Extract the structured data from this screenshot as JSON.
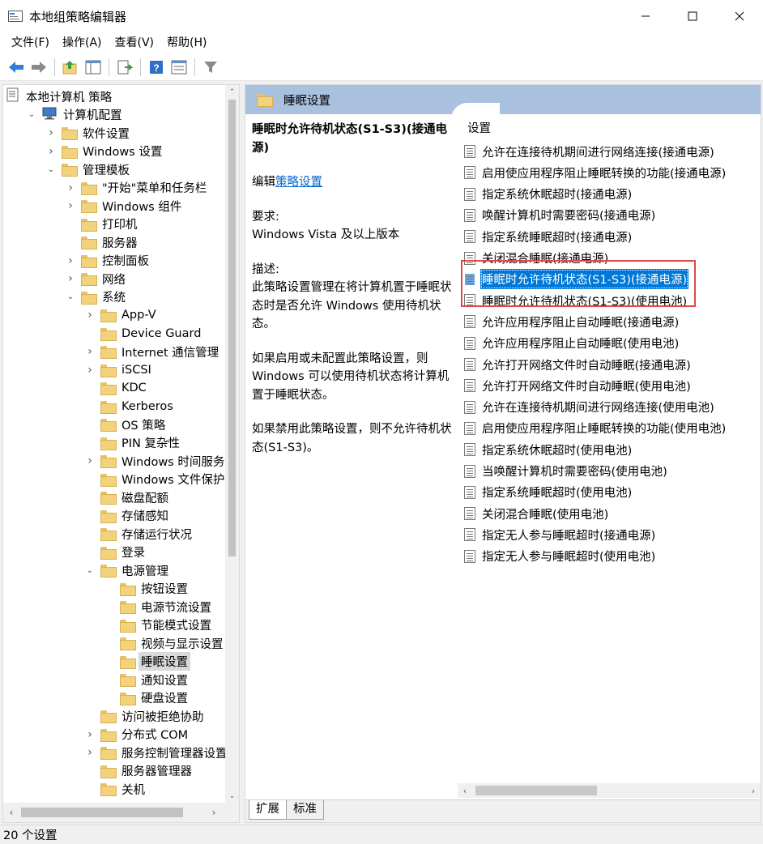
{
  "window": {
    "title": "本地组策略编辑器"
  },
  "menubar": [
    {
      "label": "文件(F)"
    },
    {
      "label": "操作(A)"
    },
    {
      "label": "查看(V)"
    },
    {
      "label": "帮助(H)"
    }
  ],
  "tree": [
    {
      "label": "本地计算机 策略",
      "level": 0,
      "expander": "",
      "icon": "policy-icon"
    },
    {
      "label": "计算机配置",
      "level": 1,
      "expander": "open",
      "icon": "computer-icon"
    },
    {
      "label": "软件设置",
      "level": 2,
      "expander": "closed",
      "icon": "folder-icon"
    },
    {
      "label": "Windows 设置",
      "level": 2,
      "expander": "closed",
      "icon": "folder-icon"
    },
    {
      "label": "管理模板",
      "level": 2,
      "expander": "open",
      "icon": "folder-icon"
    },
    {
      "label": "\"开始\"菜单和任务栏",
      "level": 3,
      "expander": "closed",
      "icon": "folder-icon"
    },
    {
      "label": "Windows 组件",
      "level": 3,
      "expander": "closed",
      "icon": "folder-icon"
    },
    {
      "label": "打印机",
      "level": 3,
      "expander": "",
      "icon": "folder-icon"
    },
    {
      "label": "服务器",
      "level": 3,
      "expander": "",
      "icon": "folder-icon"
    },
    {
      "label": "控制面板",
      "level": 3,
      "expander": "closed",
      "icon": "folder-icon"
    },
    {
      "label": "网络",
      "level": 3,
      "expander": "closed",
      "icon": "folder-icon"
    },
    {
      "label": "系统",
      "level": 3,
      "expander": "open",
      "icon": "folder-icon"
    },
    {
      "label": "App-V",
      "level": 4,
      "expander": "closed",
      "icon": "folder-icon"
    },
    {
      "label": "Device Guard",
      "level": 4,
      "expander": "",
      "icon": "folder-icon"
    },
    {
      "label": "Internet 通信管理",
      "level": 4,
      "expander": "closed",
      "icon": "folder-icon"
    },
    {
      "label": "iSCSI",
      "level": 4,
      "expander": "closed",
      "icon": "folder-icon"
    },
    {
      "label": "KDC",
      "level": 4,
      "expander": "",
      "icon": "folder-icon"
    },
    {
      "label": "Kerberos",
      "level": 4,
      "expander": "",
      "icon": "folder-icon"
    },
    {
      "label": "OS 策略",
      "level": 4,
      "expander": "",
      "icon": "folder-icon"
    },
    {
      "label": "PIN 复杂性",
      "level": 4,
      "expander": "",
      "icon": "folder-icon"
    },
    {
      "label": "Windows 时间服务",
      "level": 4,
      "expander": "closed",
      "icon": "folder-icon"
    },
    {
      "label": "Windows 文件保护",
      "level": 4,
      "expander": "",
      "icon": "folder-icon"
    },
    {
      "label": "磁盘配额",
      "level": 4,
      "expander": "",
      "icon": "folder-icon"
    },
    {
      "label": "存储感知",
      "level": 4,
      "expander": "",
      "icon": "folder-icon"
    },
    {
      "label": "存储运行状况",
      "level": 4,
      "expander": "",
      "icon": "folder-icon"
    },
    {
      "label": "登录",
      "level": 4,
      "expander": "",
      "icon": "folder-icon"
    },
    {
      "label": "电源管理",
      "level": 4,
      "expander": "open",
      "icon": "folder-icon"
    },
    {
      "label": "按钮设置",
      "level": 5,
      "expander": "",
      "icon": "folder-icon"
    },
    {
      "label": "电源节流设置",
      "level": 5,
      "expander": "",
      "icon": "folder-icon"
    },
    {
      "label": "节能模式设置",
      "level": 5,
      "expander": "",
      "icon": "folder-icon"
    },
    {
      "label": "视频与显示设置",
      "level": 5,
      "expander": "",
      "icon": "folder-icon"
    },
    {
      "label": "睡眠设置",
      "level": 5,
      "expander": "",
      "icon": "folder-icon",
      "selected": true
    },
    {
      "label": "通知设置",
      "level": 5,
      "expander": "",
      "icon": "folder-icon"
    },
    {
      "label": "硬盘设置",
      "level": 5,
      "expander": "",
      "icon": "folder-icon"
    },
    {
      "label": "访问被拒绝协助",
      "level": 4,
      "expander": "",
      "icon": "folder-icon"
    },
    {
      "label": "分布式 COM",
      "level": 4,
      "expander": "closed",
      "icon": "folder-icon"
    },
    {
      "label": "服务控制管理器设置",
      "level": 4,
      "expander": "closed",
      "icon": "folder-icon"
    },
    {
      "label": "服务器管理器",
      "level": 4,
      "expander": "",
      "icon": "folder-icon"
    },
    {
      "label": "关机",
      "level": 4,
      "expander": "",
      "icon": "folder-icon"
    }
  ],
  "right": {
    "header_title": "睡眠设置",
    "description": {
      "policy_title": "睡眠时允许待机状态(S1-S3)(接通电源)",
      "edit_prefix": "编辑",
      "edit_link": "策略设置",
      "requirements_label": "要求:",
      "requirements_value": "Windows Vista 及以上版本",
      "description_label": "描述:",
      "paragraph1": "此策略设置管理在将计算机置于睡眠状态时是否允许 Windows 使用待机状态。",
      "paragraph2": "如果启用或未配置此策略设置，则 Windows 可以使用待机状态将计算机置于睡眠状态。",
      "paragraph3": "如果禁用此策略设置，则不允许待机状态(S1-S3)。"
    },
    "list_header": "设置",
    "settings": [
      {
        "label": "允许在连接待机期间进行网络连接(接通电源)"
      },
      {
        "label": "启用使应用程序阻止睡眠转换的功能(接通电源)"
      },
      {
        "label": "指定系统休眠超时(接通电源)"
      },
      {
        "label": "唤醒计算机时需要密码(接通电源)"
      },
      {
        "label": "指定系统睡眠超时(接通电源)"
      },
      {
        "label": "关闭混合睡眠(接通电源)"
      },
      {
        "label": "睡眠时允许待机状态(S1-S3)(接通电源)",
        "selected": true
      },
      {
        "label": "睡眠时允许待机状态(S1-S3)(使用电池)"
      },
      {
        "label": "允许应用程序阻止自动睡眠(接通电源)"
      },
      {
        "label": "允许应用程序阻止自动睡眠(使用电池)"
      },
      {
        "label": "允许打开网络文件时自动睡眠(接通电源)"
      },
      {
        "label": "允许打开网络文件时自动睡眠(使用电池)"
      },
      {
        "label": "允许在连接待机期间进行网络连接(使用电池)"
      },
      {
        "label": "启用使应用程序阻止睡眠转换的功能(使用电池)"
      },
      {
        "label": "指定系统休眠超时(使用电池)"
      },
      {
        "label": "当唤醒计算机时需要密码(使用电池)"
      },
      {
        "label": "指定系统睡眠超时(使用电池)"
      },
      {
        "label": "关闭混合睡眠(使用电池)"
      },
      {
        "label": "指定无人参与睡眠超时(接通电源)"
      },
      {
        "label": "指定无人参与睡眠超时(使用电池)"
      }
    ],
    "tabs": [
      {
        "label": "扩展",
        "active": true
      },
      {
        "label": "标准",
        "active": false
      }
    ]
  },
  "statusbar": {
    "text": "20 个设置"
  },
  "colors": {
    "selection": "#0078d7",
    "header_band": "#a9c0df",
    "highlight_box": "#e04848",
    "link": "#0066cc"
  }
}
